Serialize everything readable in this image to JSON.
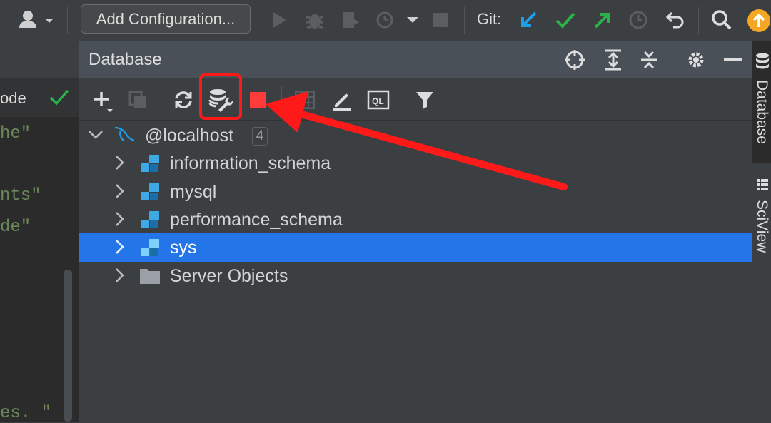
{
  "toolbar": {
    "add_configuration_label": "Add Configuration...",
    "git_label": "Git:"
  },
  "editor": {
    "tab_partial": "ode",
    "code_lines": [
      "he\"",
      "nts\"",
      "de\"",
      "es. \""
    ]
  },
  "database_panel": {
    "title": "Database",
    "tree": {
      "root": {
        "label": "@localhost",
        "count": "4"
      },
      "items": [
        {
          "label": "information_schema",
          "type": "schema",
          "selected": false
        },
        {
          "label": "mysql",
          "type": "schema",
          "selected": false
        },
        {
          "label": "performance_schema",
          "type": "schema",
          "selected": false
        },
        {
          "label": "sys",
          "type": "schema",
          "selected": true
        },
        {
          "label": "Server Objects",
          "type": "folder",
          "selected": false
        }
      ]
    },
    "toolbar_icons": [
      "plus-icon",
      "copy-icon",
      "refresh-icon",
      "data-source-properties-icon",
      "stop-icon",
      "table-icon",
      "edit-icon",
      "query-console-icon",
      "filter-icon"
    ]
  },
  "right_strip": {
    "tabs": [
      "Database",
      "SciView"
    ]
  },
  "colors": {
    "selection": "#2476e8",
    "highlight": "#ff1a1a",
    "git_update": "#1f9ee8",
    "git_commit": "#2bb14a",
    "git_push": "#2bb14a",
    "update_badge": "#f5a623"
  }
}
